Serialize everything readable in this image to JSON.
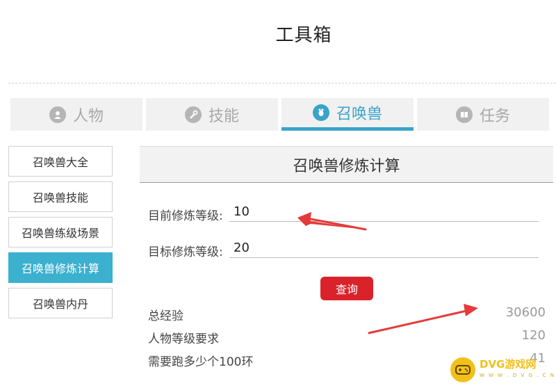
{
  "header": {
    "title": "工具箱"
  },
  "tabs": [
    {
      "label": "人物",
      "icon": "person-icon"
    },
    {
      "label": "技能",
      "icon": "wrench-icon"
    },
    {
      "label": "召唤兽",
      "icon": "pet-icon"
    },
    {
      "label": "任务",
      "icon": "book-icon"
    }
  ],
  "active_tab": "召唤兽",
  "sidebar": {
    "items": [
      {
        "label": "召唤兽大全"
      },
      {
        "label": "召唤兽技能"
      },
      {
        "label": "召唤兽练级场景"
      },
      {
        "label": "召唤兽修炼计算"
      },
      {
        "label": "召唤兽内丹"
      }
    ],
    "active_index": 3
  },
  "panel": {
    "title": "召唤兽修炼计算",
    "current_level_label": "目前修炼等级:",
    "current_level_value": "10",
    "target_level_label": "目标修炼等级:",
    "target_level_value": "20",
    "query_label": "查询"
  },
  "results": [
    {
      "label": "总经验",
      "value": "30600"
    },
    {
      "label": "人物等级要求",
      "value": "120"
    },
    {
      "label": "需要跑多少个100环",
      "value": "41"
    }
  ],
  "watermark": {
    "text": "DVG游戏网",
    "sub": "W W W . D V G . C N"
  },
  "colors": {
    "accent": "#3aa3c9",
    "sidebar_active": "#3bb0cf",
    "button": "#d9222a",
    "arrow": "#e53a3a",
    "watermark": "#f2c01a"
  }
}
